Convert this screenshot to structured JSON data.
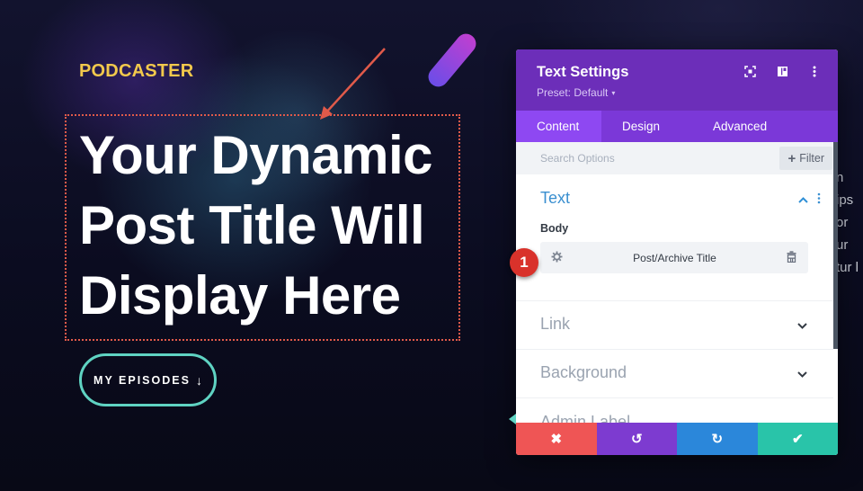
{
  "page": {
    "brand": "PODCASTER",
    "title": "Your Dynamic Post Title Will Display Here",
    "episodes_button": {
      "label": "MY EPISODES",
      "arrow": "↓"
    },
    "background_text_fragments": [
      "n ips",
      "or ur",
      "tur l"
    ]
  },
  "annotation": {
    "step_number": "1",
    "arrow_color": "#e05a4a"
  },
  "panel": {
    "title": "Text Settings",
    "preset_label": "Preset: Default",
    "preset_caret": "▾",
    "header_icons": [
      "fullscreen-icon",
      "split-view-icon",
      "more-options-icon"
    ],
    "tabs": [
      {
        "label": "Content",
        "active": true
      },
      {
        "label": "Design",
        "active": false
      },
      {
        "label": "Advanced",
        "active": false
      }
    ],
    "search": {
      "placeholder": "Search Options",
      "value": ""
    },
    "filter_button": {
      "icon": "+",
      "label": "Filter"
    },
    "sections": {
      "text": {
        "title": "Text",
        "expanded": true,
        "body_label": "Body",
        "dynamic_field_value": "Post/Archive Title"
      },
      "link": {
        "title": "Link",
        "expanded": false
      },
      "background": {
        "title": "Background",
        "expanded": false
      },
      "admin_label": {
        "title": "Admin Label",
        "expanded": false
      }
    },
    "footer": {
      "cancel_icon": "✖",
      "undo_icon": "↺",
      "redo_icon": "↻",
      "save_icon": "✔"
    }
  },
  "colors": {
    "brand_yellow": "#f2c94c",
    "panel_header": "#6c2eb9",
    "tabs_bg": "#7b38d8",
    "tab_active": "#8e48f2",
    "cancel": "#ef5555",
    "undo": "#7d3bd0",
    "redo": "#2b87da",
    "save": "#29c4a9",
    "button_outline": "#5fd3c2",
    "badge": "#d9322b"
  }
}
